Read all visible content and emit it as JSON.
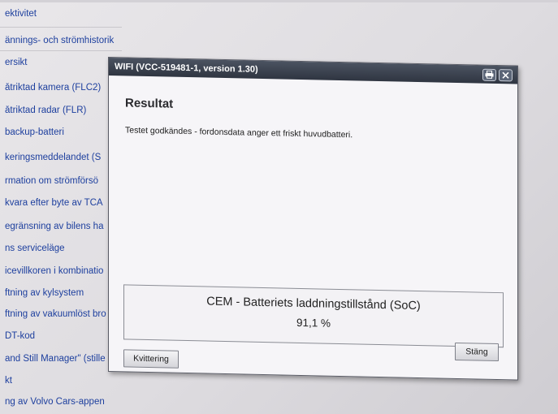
{
  "background": {
    "items": [
      "ektivitet",
      "ännings- och strömhistorik",
      "ersikt",
      "åtriktad kamera (FLC2)",
      "åtriktad radar (FLR)",
      " backup-batteri",
      "keringsmeddelandet (S",
      "rmation om strömförsö",
      "kvara efter byte av TCA",
      "egränsning av bilens ha",
      "ns serviceläge",
      "icevillkoren i kombinatio",
      "ftning av kylsystem",
      "ftning av vakuumlöst bro",
      "DT-kod",
      "and Still Manager\" (stille",
      "kt",
      "ng av Volvo Cars-appen"
    ]
  },
  "dialog": {
    "title": "WIFI  (VCC-519481-1, version 1.30)",
    "heading": "Resultat",
    "message": "Testet godkändes - fordonsdata anger ett friskt huvudbatteri.",
    "result_label": "CEM - Batteriets laddningstillstånd (SoC)",
    "result_value": "91,1 %",
    "close_button": "Stäng",
    "ack_button": "Kvittering"
  },
  "colors": {
    "link": "#1d3f9e",
    "titlebar": "#2f3541",
    "dialog_bg": "#f6f5f8"
  },
  "icons": [
    "print-icon",
    "close-icon"
  ]
}
